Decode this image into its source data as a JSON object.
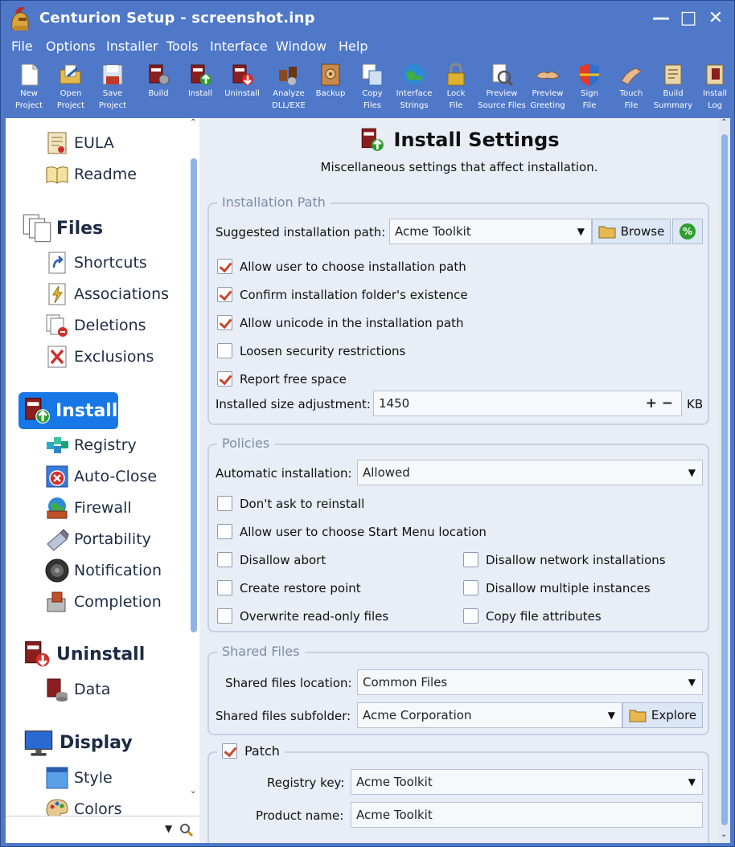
{
  "window": {
    "title": "Centurion Setup - screenshot.inp",
    "minimize_glyph": "—",
    "maximize_glyph": "□",
    "close_glyph": "✕"
  },
  "menu": [
    "File",
    "Options",
    "Installer",
    "Tools",
    "Interface",
    "Window",
    "Help"
  ],
  "toolbar": [
    {
      "line1": "New",
      "line2": "Project",
      "icon": "new-project-icon"
    },
    {
      "line1": "Open",
      "line2": "Project",
      "icon": "open-project-icon"
    },
    {
      "line1": "Save",
      "line2": "Project",
      "icon": "save-project-icon"
    },
    {
      "line1": "Build",
      "line2": "",
      "icon": "build-icon"
    },
    {
      "line1": "Install",
      "line2": "",
      "icon": "install-icon"
    },
    {
      "line1": "Uninstall",
      "line2": "",
      "icon": "uninstall-icon"
    },
    {
      "line1": "Analyze",
      "line2": "DLL/EXE",
      "icon": "analyze-icon"
    },
    {
      "line1": "Backup",
      "line2": "",
      "icon": "backup-icon"
    },
    {
      "line1": "Copy",
      "line2": "Files",
      "icon": "copy-files-icon"
    },
    {
      "line1": "Interface",
      "line2": "Strings",
      "icon": "interface-strings-icon"
    },
    {
      "line1": "Lock",
      "line2": "File",
      "icon": "lock-icon"
    },
    {
      "line1": "Preview",
      "line2": "Source Files",
      "icon": "preview-source-icon"
    },
    {
      "line1": "Preview",
      "line2": "Greeting",
      "icon": "preview-greeting-icon"
    },
    {
      "line1": "Sign",
      "line2": "File",
      "icon": "shield-icon"
    },
    {
      "line1": "Touch",
      "line2": "File",
      "icon": "touch-icon"
    },
    {
      "line1": "Build",
      "line2": "Summary",
      "icon": "build-summary-icon"
    },
    {
      "line1": "Install",
      "line2": "Log",
      "icon": "install-log-icon"
    }
  ],
  "sidebar": {
    "eula": "EULA",
    "readme": "Readme",
    "files": "Files",
    "shortcuts": "Shortcuts",
    "associations": "Associations",
    "deletions": "Deletions",
    "exclusions": "Exclusions",
    "install": "Install",
    "registry": "Registry",
    "auto_close": "Auto-Close",
    "firewall": "Firewall",
    "portability": "Portability",
    "notification": "Notification",
    "completion": "Completion",
    "uninstall": "Uninstall",
    "data": "Data",
    "display": "Display",
    "style": "Style",
    "colors": "Colors"
  },
  "main": {
    "title": "Install Settings",
    "subtitle": "Miscellaneous settings that affect installation.",
    "installation_path": {
      "group_title": "Installation Path",
      "suggested_label": "Suggested installation path:",
      "suggested_value": "Acme Toolkit",
      "browse_label": "Browse",
      "options": [
        {
          "label": "Allow user to choose installation path",
          "checked": true
        },
        {
          "label": "Confirm installation folder's existence",
          "checked": true
        },
        {
          "label": "Allow unicode in the installation path",
          "checked": true
        },
        {
          "label": "Loosen security restrictions",
          "checked": false
        },
        {
          "label": "Report free space",
          "checked": true
        }
      ],
      "size_label": "Installed size adjustment:",
      "size_value": "1450",
      "size_unit": "KB",
      "plus": "+",
      "minus": "−"
    },
    "policies": {
      "group_title": "Policies",
      "auto_label": "Automatic installation:",
      "auto_value": "Allowed",
      "dont_ask": "Don't ask to reinstall",
      "start_menu": "Allow user to choose Start Menu location",
      "disallow_abort": "Disallow abort",
      "create_restore": "Create restore point",
      "overwrite_readonly": "Overwrite read-only files",
      "disallow_network": "Disallow network installations",
      "disallow_multiple": "Disallow multiple instances",
      "copy_attributes": "Copy file attributes"
    },
    "shared_files": {
      "group_title": "Shared Files",
      "location_label": "Shared files location:",
      "location_value": "Common Files",
      "subfolder_label": "Shared files subfolder:",
      "subfolder_value": "Acme Corporation",
      "explore_label": "Explore"
    },
    "patch": {
      "group_title": "Patch",
      "checked": true,
      "registry_label": "Registry key:",
      "registry_value": "Acme Toolkit",
      "product_label": "Product name:",
      "product_value": "Acme Toolkit"
    }
  },
  "colors": {
    "window_chrome": "#4f78c9",
    "selected_nav": "#1877e6",
    "check_mark": "#c8462a",
    "panel_bg": "#e8edf6"
  }
}
